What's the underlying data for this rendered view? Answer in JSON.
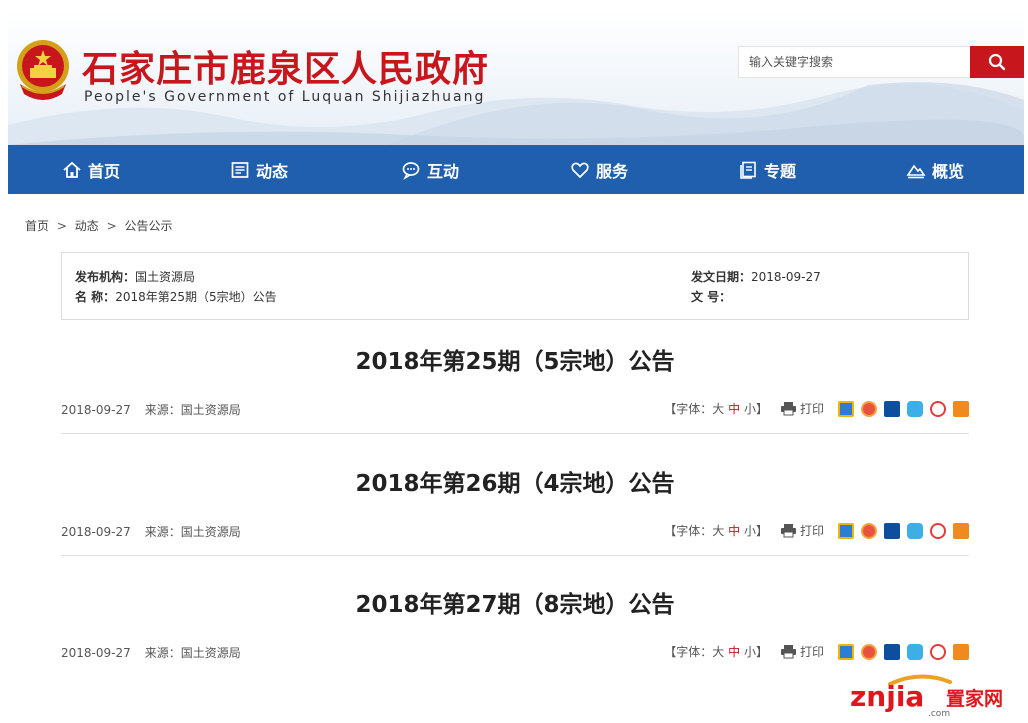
{
  "header": {
    "title": "石家庄市鹿泉区人民政府",
    "subtitle": "People's Government of Luquan Shijiazhuang",
    "search_placeholder": "输入关键字搜索",
    "colors": {
      "brand_red": "#c8161d",
      "nav_blue": "#1f5fae"
    }
  },
  "nav": {
    "items": [
      {
        "label": "首页",
        "icon": "home-icon"
      },
      {
        "label": "动态",
        "icon": "news-icon"
      },
      {
        "label": "互动",
        "icon": "chat-icon"
      },
      {
        "label": "服务",
        "icon": "heart-icon"
      },
      {
        "label": "专题",
        "icon": "document-icon"
      },
      {
        "label": "概览",
        "icon": "landscape-icon"
      }
    ]
  },
  "breadcrumb": {
    "items": [
      "首页",
      "动态",
      "公告公示"
    ],
    "separator": ">"
  },
  "info": {
    "publisher_label": "发布机构：",
    "publisher": "国土资源局",
    "name_label": "名  称：",
    "name": "2018年第25期（5宗地）公告",
    "date_label": "发文日期：",
    "date": "2018-09-27",
    "docno_label": "文  号："
  },
  "articles": [
    {
      "title": "2018年第25期（5宗地）公告",
      "date": "2018-09-27",
      "source": "来源：国土资源局"
    },
    {
      "title": "2018年第26期（4宗地）公告",
      "date": "2018-09-27",
      "source": "来源：国土资源局"
    },
    {
      "title": "2018年第27期（8宗地）公告",
      "date": "2018-09-27",
      "source": "来源：国土资源局"
    }
  ],
  "tools": {
    "font_open": "【字体：",
    "font_large": "大",
    "font_medium": "中",
    "font_small": "小",
    "font_close": "】",
    "print": "打印",
    "share_icons": [
      "qzone-icon",
      "weibo-icon",
      "renren-icon",
      "qq-icon",
      "tencent-weibo-icon",
      "more-share-icon"
    ]
  },
  "watermark": {
    "brand": "znjia",
    "brand_cn": "置家网",
    "domain": ".com"
  }
}
